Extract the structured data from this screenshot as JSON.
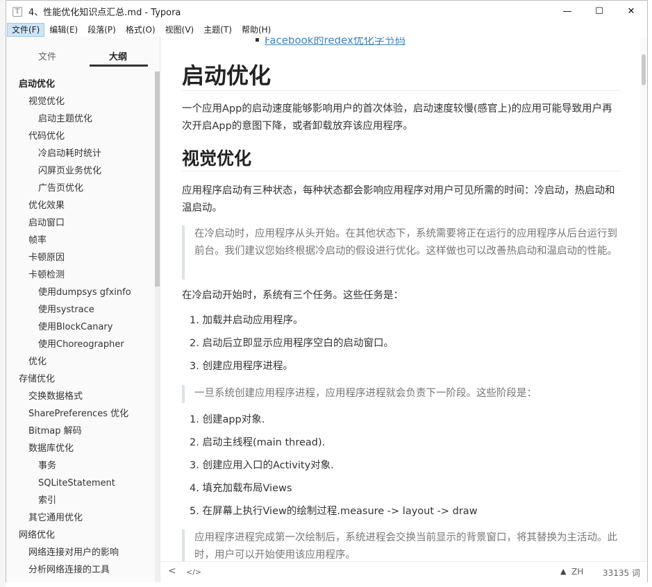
{
  "window": {
    "title": "4、性能优化知识点汇总.md - Typora",
    "icon_glyph": "T",
    "minimize": "—",
    "maximize": "☐",
    "close": "✕"
  },
  "menu": [
    "文件(F)",
    "编辑(E)",
    "段落(P)",
    "格式(O)",
    "视图(V)",
    "主题(T)",
    "帮助(H)"
  ],
  "sidebar": {
    "tabs": [
      "文件",
      "大纲"
    ],
    "outline": [
      {
        "level": 1,
        "text": "启动优化",
        "selected": true
      },
      {
        "level": 2,
        "text": "视觉优化"
      },
      {
        "level": 3,
        "text": "启动主题优化"
      },
      {
        "level": 2,
        "text": "代码优化"
      },
      {
        "level": 3,
        "text": "冷启动耗时统计"
      },
      {
        "level": 3,
        "text": "闪屏页业务优化"
      },
      {
        "level": 3,
        "text": "广告页优化"
      },
      {
        "level": 2,
        "text": "优化效果"
      },
      {
        "level": 2,
        "text": "启动窗口"
      },
      {
        "level": 2,
        "text": "帧率"
      },
      {
        "level": 2,
        "text": "卡顿原因"
      },
      {
        "level": 2,
        "text": "卡顿检测"
      },
      {
        "level": 3,
        "text": "使用dumpsys gfxinfo"
      },
      {
        "level": 3,
        "text": "使用systrace"
      },
      {
        "level": 3,
        "text": "使用BlockCanary"
      },
      {
        "level": 3,
        "text": "使用Choreographer"
      },
      {
        "level": 2,
        "text": "优化"
      },
      {
        "level": 1,
        "text": "存储优化"
      },
      {
        "level": 2,
        "text": "交换数据格式"
      },
      {
        "level": 2,
        "text": "SharePreferences 优化"
      },
      {
        "level": 2,
        "text": "Bitmap 解码"
      },
      {
        "level": 2,
        "text": "数据库优化"
      },
      {
        "level": 3,
        "text": "事务"
      },
      {
        "level": 3,
        "text": "SQLiteStatement"
      },
      {
        "level": 3,
        "text": "索引"
      },
      {
        "level": 2,
        "text": "其它通用优化"
      },
      {
        "level": 1,
        "text": "网络优化"
      },
      {
        "level": 2,
        "text": "网络连接对用户的影响"
      },
      {
        "level": 2,
        "text": "分析网络连接的工具"
      }
    ]
  },
  "doc": {
    "top_link": "Facebook的redex优化字节码",
    "h1": "启动优化",
    "intro": "一个应用App的启动速度能够影响用户的首次体验，启动速度较慢(感官上)的应用可能导致用户再次开启App的意图下降，或者卸载放弃该应用程序。",
    "h2": "视觉优化",
    "p1": "应用程序启动有三种状态，每种状态都会影响应用程序对用户可见所需的时间：冷启动，热启动和温启动。",
    "quote1": "在冷启动时，应用程序从头开始。在其他状态下，系统需要将正在运行的应用程序从后台运行到前台。我们建议您始终根据冷启动的假设进行优化。这样做也可以改善热启动和温启动的性能。",
    "p2": "在冷启动开始时，系统有三个任务。这些任务是：",
    "list1": [
      "1. 加载并启动应用程序。",
      "2. 启动后立即显示应用程序空白的启动窗口。",
      "3. 创建应用程序进程。"
    ],
    "quote2": "一旦系统创建应用程序进程，应用程序进程就会负责下一阶段。这些阶段是：",
    "list2": [
      "1. 创建app对象.",
      "2. 启动主线程(main thread).",
      "3. 创建应用入口的Activity对象.",
      "4. 填充加载布局Views",
      "5. 在屏幕上执行View的绘制过程.measure -> layout -> draw"
    ],
    "quote3": "应用程序进程完成第一次绘制后，系统进程会交换当前显示的背景窗口，将其替换为主活动。此时，用户可以开始使用该应用程序。"
  },
  "status": {
    "back": "<",
    "source": "</>",
    "warn_icon": "▲",
    "lang": "ZH",
    "words": "33135 词"
  }
}
